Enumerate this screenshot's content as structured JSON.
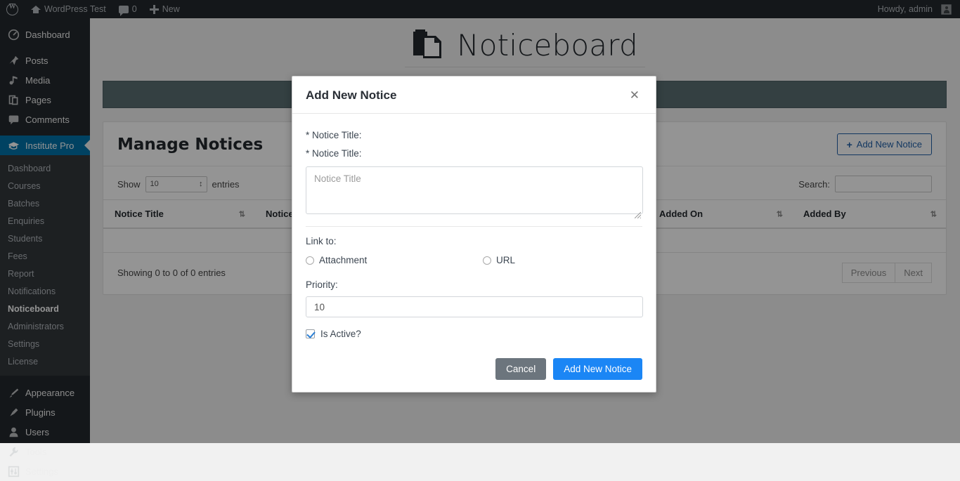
{
  "adminbar": {
    "logo_icon": "wordpress-logo-icon",
    "site_name": "WordPress Test",
    "home_icon": "home-icon",
    "comments_icon": "comment-bubble-icon",
    "comments_count": "0",
    "new_icon": "plus-icon",
    "new_label": "New",
    "howdy": "Howdy, admin",
    "avatar_icon": "avatar-icon"
  },
  "sidebar": {
    "top_items": [
      {
        "label": "Dashboard",
        "icon": "dashboard-icon"
      },
      {
        "label": "Posts",
        "icon": "pin-icon"
      },
      {
        "label": "Media",
        "icon": "media-icon"
      },
      {
        "label": "Pages",
        "icon": "pages-icon"
      },
      {
        "label": "Comments",
        "icon": "comment-bubble-icon"
      },
      {
        "label": "Institute Pro",
        "icon": "graduation-cap-icon"
      }
    ],
    "submenu": [
      "Dashboard",
      "Courses",
      "Batches",
      "Enquiries",
      "Students",
      "Fees",
      "Report",
      "Notifications",
      "Noticeboard",
      "Administrators",
      "Settings",
      "License"
    ],
    "current_submenu": "Noticeboard",
    "bottom_items": [
      {
        "label": "Appearance",
        "icon": "paintbrush-icon"
      },
      {
        "label": "Plugins",
        "icon": "plug-icon"
      },
      {
        "label": "Users",
        "icon": "user-icon"
      },
      {
        "label": "Tools",
        "icon": "wrench-icon"
      },
      {
        "label": "Settings",
        "icon": "sliders-icon"
      }
    ],
    "active_item": "Institute Pro",
    "active_color": "#0073aa"
  },
  "page": {
    "brand_icon": "noticeboard-book-icon",
    "brand_name": "Noticeboard",
    "banner_text": "",
    "panel_title": "Manage Notices",
    "add_button_label": "Add New Notice",
    "add_button_icon": "plus-icon",
    "add_button_color": "#1f5fa8",
    "show_label": "Show",
    "entries_label": "entries",
    "page_length": "10",
    "search_label": "Search:",
    "search_value": "",
    "table": {
      "columns": [
        "Notice Title",
        "Notice",
        "Added On",
        "Added By"
      ],
      "sort_icon": "sort-arrows-icon",
      "rows": []
    },
    "info_text": "Showing 0 to 0 of 0 entries",
    "pager": {
      "previous": "Previous",
      "next": "Next"
    }
  },
  "modal": {
    "title": "Add New Notice",
    "close_icon": "close-icon",
    "label_notice_title_1": "* Notice Title:",
    "label_notice_title_2": "* Notice Title:",
    "notice_title_value": "",
    "notice_title_placeholder": "Notice Title",
    "link_to_label": "Link to:",
    "radio_attachment_label": "Attachment",
    "radio_url_label": "URL",
    "radio_selected": "",
    "priority_label": "Priority:",
    "priority_value": "10",
    "is_active_label": "Is Active?",
    "is_active_checked": true,
    "cancel_label": "Cancel",
    "submit_label": "Add New Notice",
    "submit_color": "#1b86f5",
    "cancel_color": "#6c757d"
  }
}
